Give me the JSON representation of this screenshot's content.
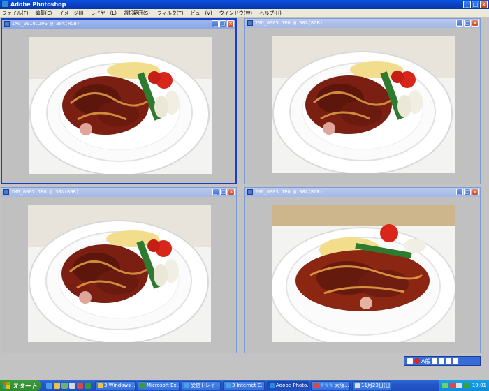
{
  "app": {
    "title": "Adobe Photoshop"
  },
  "window_buttons": {
    "minimize": "_",
    "maximize": "□",
    "close": "×"
  },
  "menu": [
    "ファイル(F)",
    "編集(E)",
    "イメージ(I)",
    "レイヤー(L)",
    "選択範囲(S)",
    "フィルタ(T)",
    "ビュー(V)",
    "ウインドウ(W)",
    "ヘルプ(H)"
  ],
  "documents": [
    {
      "title": "IMG_0010.JPG @ 30%(RGB)",
      "active": true
    },
    {
      "title": "IMG_0005.JPG @ 30%(RGB)",
      "active": false
    },
    {
      "title": "IMG_0007.JPG @ 30%(RGB)",
      "active": false
    },
    {
      "title": "IMG_0003.JPG @ 30%(RGB)",
      "active": false
    }
  ],
  "ime": {
    "mode": "A般"
  },
  "start": {
    "label": "スタート"
  },
  "taskbar_items": [
    {
      "label": "3 Windows ...",
      "active": false
    },
    {
      "label": "Microsoft Ex...",
      "active": false
    },
    {
      "label": "受信トレイ - ...",
      "active": false
    },
    {
      "label": "3 Internet E...",
      "active": false
    },
    {
      "label": "Adobe Photo...",
      "active": true
    },
    {
      "label": "☆☆☆ 大阪...",
      "active": false
    },
    {
      "label": "11月23日(日...",
      "active": false
    }
  ],
  "clock": "19:01"
}
